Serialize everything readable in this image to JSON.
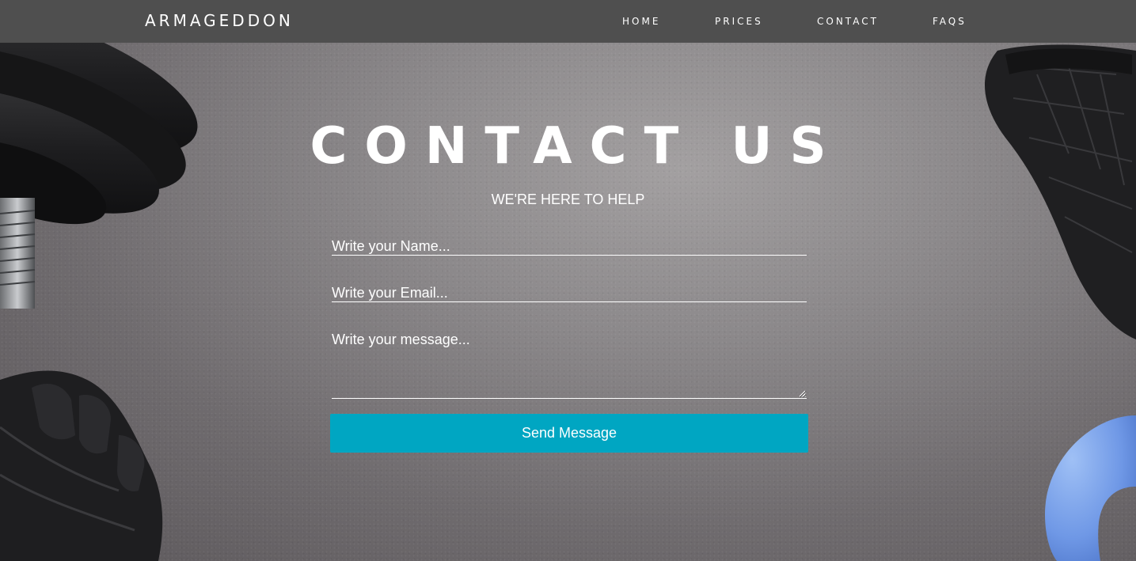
{
  "navbar": {
    "brand": "ARMAGEDDON",
    "links": [
      {
        "label": "HOME"
      },
      {
        "label": "PRICES"
      },
      {
        "label": "CONTACT"
      },
      {
        "label": "FAQS"
      }
    ]
  },
  "hero": {
    "title": "CONTACT US",
    "subtitle": "WE'RE HERE TO HELP"
  },
  "form": {
    "name_placeholder": "Write your Name...",
    "email_placeholder": "Write your Email...",
    "message_placeholder": "Write your message...",
    "submit_label": "Send Message"
  },
  "colors": {
    "navbar_bg": "#4f4f4f",
    "accent": "#00a6c2",
    "text": "#ffffff"
  },
  "icons": {
    "background_objects": [
      "dumbbell-plates",
      "leather-glove",
      "blue-ring-weight"
    ]
  }
}
